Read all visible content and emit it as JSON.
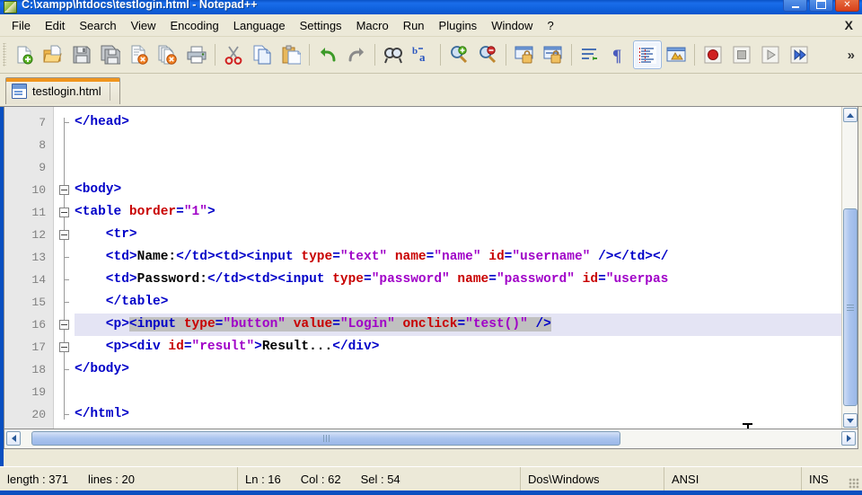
{
  "window": {
    "title": "C:\\xampp\\htdocs\\testlogin.html - Notepad++",
    "minimize_label": "Minimize",
    "maximize_label": "Maximize",
    "close_label": "Close",
    "doc_close_label": "X"
  },
  "menu": {
    "items": [
      {
        "label": "File"
      },
      {
        "label": "Edit"
      },
      {
        "label": "Search"
      },
      {
        "label": "View"
      },
      {
        "label": "Encoding"
      },
      {
        "label": "Language"
      },
      {
        "label": "Settings"
      },
      {
        "label": "Macro"
      },
      {
        "label": "Run"
      },
      {
        "label": "Plugins"
      },
      {
        "label": "Window"
      },
      {
        "label": "?"
      }
    ]
  },
  "toolbar": {
    "overflow_label": "»",
    "buttons": [
      {
        "name": "new-file-icon",
        "tip": "New"
      },
      {
        "name": "open-file-icon",
        "tip": "Open"
      },
      {
        "name": "save-icon",
        "tip": "Save"
      },
      {
        "name": "save-all-icon",
        "tip": "Save All"
      },
      {
        "name": "close-file-icon",
        "tip": "Close"
      },
      {
        "name": "close-all-icon",
        "tip": "Close All"
      },
      {
        "name": "print-icon",
        "tip": "Print"
      },
      {
        "name": "cut-icon",
        "tip": "Cut"
      },
      {
        "name": "copy-icon",
        "tip": "Copy"
      },
      {
        "name": "paste-icon",
        "tip": "Paste"
      },
      {
        "name": "undo-icon",
        "tip": "Undo"
      },
      {
        "name": "redo-icon",
        "tip": "Redo"
      },
      {
        "name": "find-icon",
        "tip": "Find"
      },
      {
        "name": "replace-icon",
        "tip": "Replace"
      },
      {
        "name": "zoom-in-icon",
        "tip": "Zoom In"
      },
      {
        "name": "zoom-out-icon",
        "tip": "Zoom Out"
      },
      {
        "name": "sync-vertical-icon",
        "tip": "Synchronize Vertical Scrolling"
      },
      {
        "name": "sync-horizontal-icon",
        "tip": "Synchronize Horizontal Scrolling"
      },
      {
        "name": "word-wrap-icon",
        "tip": "Word Wrap"
      },
      {
        "name": "show-all-chars-icon",
        "tip": "Show All Characters"
      },
      {
        "name": "indent-guide-icon",
        "tip": "Show Indent Guide"
      },
      {
        "name": "user-defined-dialog-icon",
        "tip": "User Defined Dialogue"
      },
      {
        "name": "record-macro-icon",
        "tip": "Start Recording"
      },
      {
        "name": "stop-macro-icon",
        "tip": "Stop Recording"
      },
      {
        "name": "play-macro-icon",
        "tip": "Playback"
      },
      {
        "name": "run-macro-multiple-icon",
        "tip": "Run a Macro Multiple Times"
      }
    ]
  },
  "tabs": [
    {
      "label": "testlogin.html",
      "active": true
    }
  ],
  "editor": {
    "first_visible_line": 7,
    "current_line": 16,
    "lines": [
      {
        "num": "7",
        "fold": "tick",
        "tokens": [
          {
            "t": "tag",
            "s": "</head>"
          }
        ]
      },
      {
        "num": "8",
        "fold": "line",
        "tokens": []
      },
      {
        "num": "9",
        "fold": "line",
        "tokens": []
      },
      {
        "num": "10",
        "fold": "box",
        "tokens": [
          {
            "t": "tag",
            "s": "<body>"
          }
        ]
      },
      {
        "num": "11",
        "fold": "box",
        "tokens": [
          {
            "t": "tag",
            "s": "<table "
          },
          {
            "t": "attr",
            "s": "border"
          },
          {
            "t": "tag",
            "s": "="
          },
          {
            "t": "val",
            "s": "\"1\""
          },
          {
            "t": "tag",
            "s": ">"
          }
        ]
      },
      {
        "num": "12",
        "fold": "box",
        "tokens": [
          {
            "t": "tag",
            "s": "    <tr>"
          }
        ]
      },
      {
        "num": "13",
        "fold": "tick",
        "tokens": [
          {
            "t": "tag",
            "s": "    <td>"
          },
          {
            "t": "txt",
            "s": "Name:"
          },
          {
            "t": "tag",
            "s": "</td><td><input "
          },
          {
            "t": "attr",
            "s": "type"
          },
          {
            "t": "tag",
            "s": "="
          },
          {
            "t": "val",
            "s": "\"text\""
          },
          {
            "t": "tag",
            "s": " "
          },
          {
            "t": "attr",
            "s": "name"
          },
          {
            "t": "tag",
            "s": "="
          },
          {
            "t": "val",
            "s": "\"name\""
          },
          {
            "t": "tag",
            "s": " "
          },
          {
            "t": "attr",
            "s": "id"
          },
          {
            "t": "tag",
            "s": "="
          },
          {
            "t": "val",
            "s": "\"username\""
          },
          {
            "t": "tag",
            "s": " /></td></"
          }
        ]
      },
      {
        "num": "14",
        "fold": "tick",
        "tokens": [
          {
            "t": "tag",
            "s": "    <td>"
          },
          {
            "t": "txt",
            "s": "Password:"
          },
          {
            "t": "tag",
            "s": "</td><td><input "
          },
          {
            "t": "attr",
            "s": "type"
          },
          {
            "t": "tag",
            "s": "="
          },
          {
            "t": "val",
            "s": "\"password\""
          },
          {
            "t": "tag",
            "s": " "
          },
          {
            "t": "attr",
            "s": "name"
          },
          {
            "t": "tag",
            "s": "="
          },
          {
            "t": "val",
            "s": "\"password\""
          },
          {
            "t": "tag",
            "s": " "
          },
          {
            "t": "attr",
            "s": "id"
          },
          {
            "t": "tag",
            "s": "="
          },
          {
            "t": "val",
            "s": "\"userpas"
          }
        ]
      },
      {
        "num": "15",
        "fold": "tick",
        "tokens": [
          {
            "t": "tag",
            "s": "    </table>"
          }
        ]
      },
      {
        "num": "16",
        "fold": "box",
        "current": true,
        "tokens": [
          {
            "t": "tag",
            "s": "    <p>"
          },
          {
            "t": "tag",
            "s": "<input ",
            "sel": true
          },
          {
            "t": "attr",
            "s": "type",
            "sel": true
          },
          {
            "t": "tag",
            "s": "=",
            "sel": true
          },
          {
            "t": "val",
            "s": "\"button\"",
            "sel": true
          },
          {
            "t": "tag",
            "s": " ",
            "sel": true
          },
          {
            "t": "attr",
            "s": "value",
            "sel": true
          },
          {
            "t": "tag",
            "s": "=",
            "sel": true
          },
          {
            "t": "val",
            "s": "\"Login\"",
            "sel": true
          },
          {
            "t": "tag",
            "s": " ",
            "sel": true
          },
          {
            "t": "attr",
            "s": "onclick",
            "sel": true
          },
          {
            "t": "tag",
            "s": "=",
            "sel": true
          },
          {
            "t": "val",
            "s": "\"test()\"",
            "sel": true
          },
          {
            "t": "tag",
            "s": " />",
            "sel": true
          }
        ]
      },
      {
        "num": "17",
        "fold": "box",
        "tokens": [
          {
            "t": "tag",
            "s": "    <p><div "
          },
          {
            "t": "attr",
            "s": "id"
          },
          {
            "t": "tag",
            "s": "="
          },
          {
            "t": "val",
            "s": "\"result\""
          },
          {
            "t": "tag",
            "s": ">"
          },
          {
            "t": "txt",
            "s": "Result..."
          },
          {
            "t": "tag",
            "s": "</div>"
          }
        ]
      },
      {
        "num": "18",
        "fold": "tick",
        "tokens": [
          {
            "t": "tag",
            "s": "</body>"
          }
        ]
      },
      {
        "num": "19",
        "fold": "line",
        "tokens": []
      },
      {
        "num": "20",
        "fold": "end",
        "tokens": [
          {
            "t": "tag",
            "s": "</html>"
          }
        ]
      }
    ]
  },
  "status": {
    "length_text": "length : 371",
    "lines_text": "lines : 20",
    "ln_text": "Ln : 16",
    "col_text": "Col : 62",
    "sel_text": "Sel : 54",
    "eol_text": "Dos\\Windows",
    "encoding_text": "ANSI",
    "insert_text": "INS"
  },
  "colors": {
    "title_blue": "#1163e0",
    "tab_active_orange": "#f0951e",
    "chrome": "#ece9d8",
    "tag": "#0000c8",
    "attribute": "#c80000",
    "value": "#a000c8",
    "text": "#000000",
    "selection": "#c0c0c0",
    "current_line": "#e4e4f4",
    "scrollbar_thumb": "#aac4ee"
  }
}
